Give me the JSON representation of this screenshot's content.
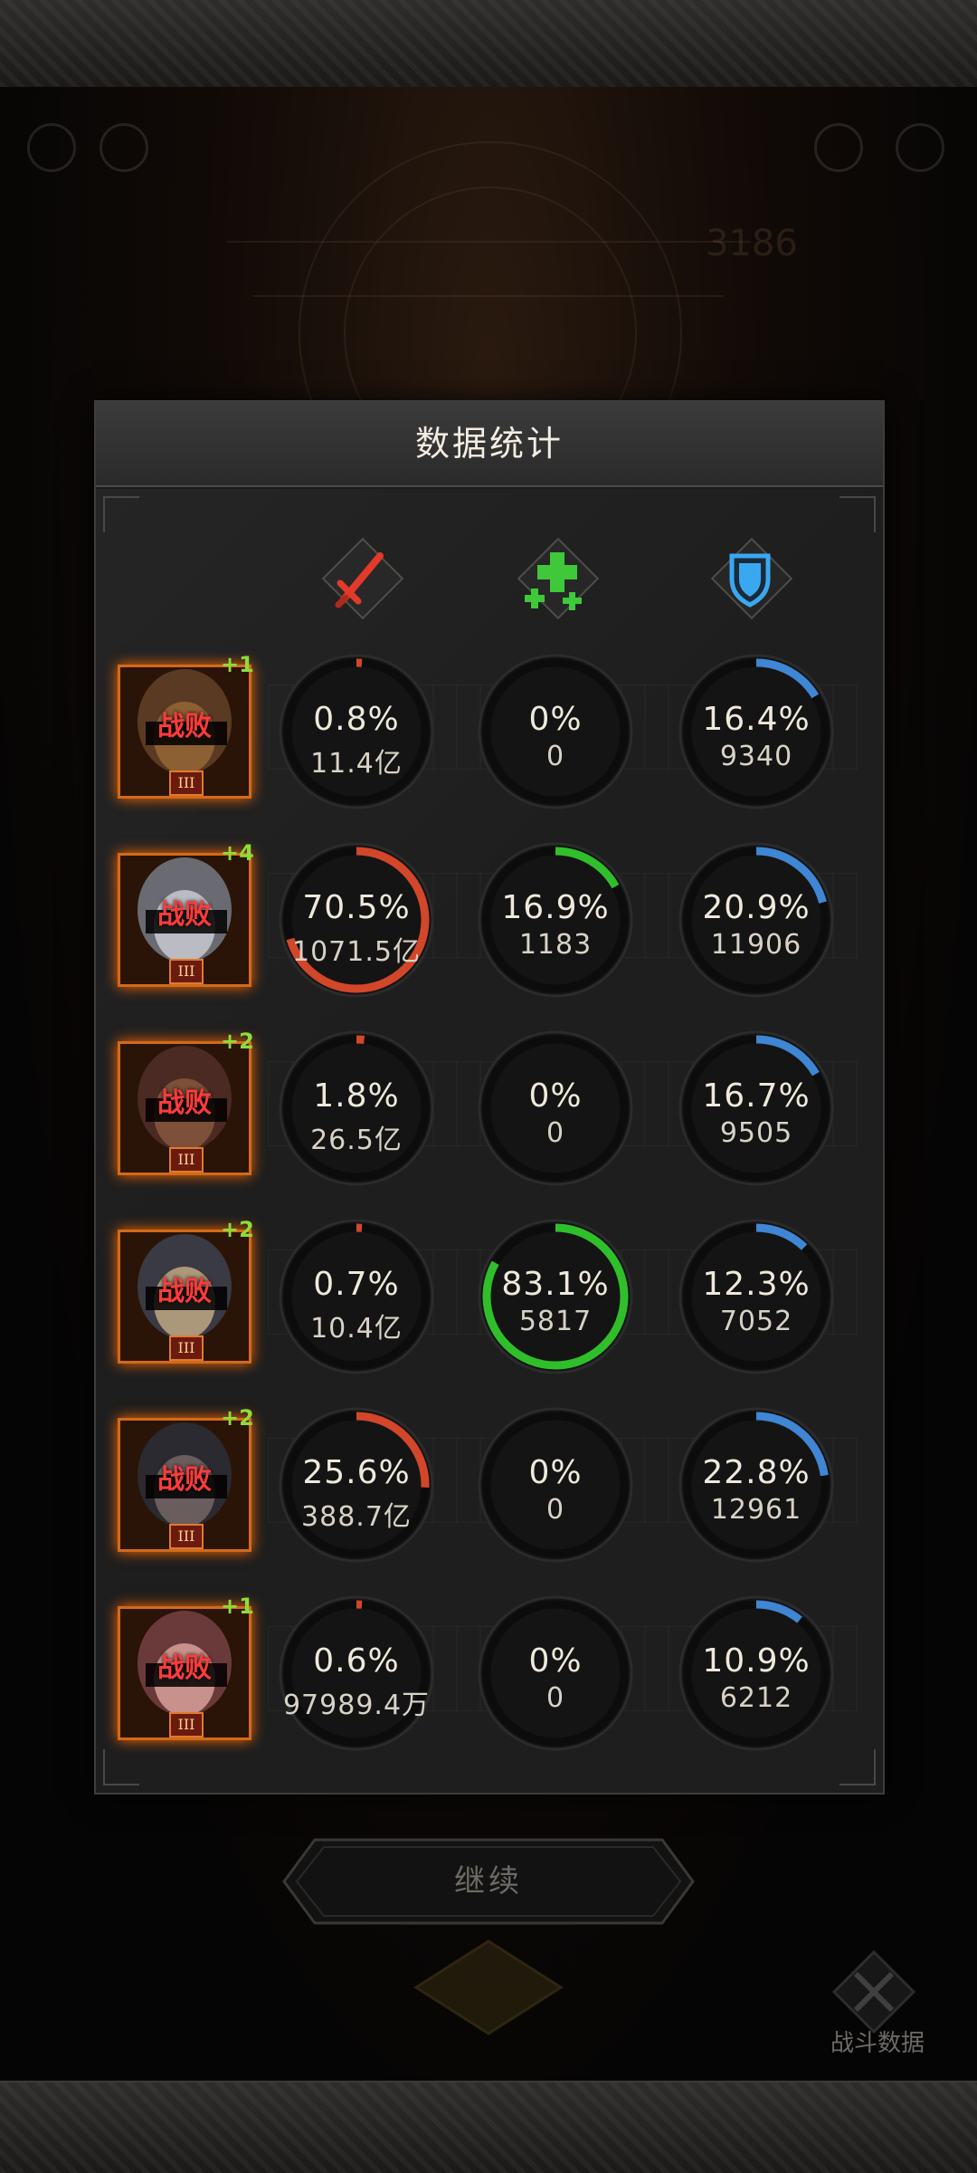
{
  "panel": {
    "title": "数据统计"
  },
  "columns": [
    {
      "icon": "sword-icon",
      "color": "#e23a2a"
    },
    {
      "icon": "heal-cross-icon",
      "color": "#3ec83a"
    },
    {
      "icon": "shield-icon",
      "color": "#3aa8f0"
    }
  ],
  "colors": {
    "damage": "#d2462a",
    "heal": "#2fbf2a",
    "tank": "#3f86d4",
    "defeat": "#ff3b3b",
    "level": "#8edc3a"
  },
  "rows": [
    {
      "plus": "+1",
      "status": "战败",
      "rank": "III",
      "stats": [
        {
          "pct": "0.8%",
          "value": "11.4亿",
          "p": 0.008
        },
        {
          "pct": "0%",
          "value": "0",
          "p": 0
        },
        {
          "pct": "16.4%",
          "value": "9340",
          "p": 0.164
        }
      ]
    },
    {
      "plus": "+4",
      "status": "战败",
      "rank": "III",
      "stats": [
        {
          "pct": "70.5%",
          "value": "1071.5亿",
          "p": 0.705
        },
        {
          "pct": "16.9%",
          "value": "1183",
          "p": 0.169
        },
        {
          "pct": "20.9%",
          "value": "11906",
          "p": 0.209
        }
      ]
    },
    {
      "plus": "+2",
      "status": "战败",
      "rank": "III",
      "stats": [
        {
          "pct": "1.8%",
          "value": "26.5亿",
          "p": 0.018
        },
        {
          "pct": "0%",
          "value": "0",
          "p": 0
        },
        {
          "pct": "16.7%",
          "value": "9505",
          "p": 0.167
        }
      ]
    },
    {
      "plus": "+2",
      "status": "战败",
      "rank": "III",
      "stats": [
        {
          "pct": "0.7%",
          "value": "10.4亿",
          "p": 0.007
        },
        {
          "pct": "83.1%",
          "value": "5817",
          "p": 0.831
        },
        {
          "pct": "12.3%",
          "value": "7052",
          "p": 0.123
        }
      ]
    },
    {
      "plus": "+2",
      "status": "战败",
      "rank": "III",
      "stats": [
        {
          "pct": "25.6%",
          "value": "388.7亿",
          "p": 0.256
        },
        {
          "pct": "0%",
          "value": "0",
          "p": 0
        },
        {
          "pct": "22.8%",
          "value": "12961",
          "p": 0.228
        }
      ]
    },
    {
      "plus": "+1",
      "status": "战败",
      "rank": "III",
      "stats": [
        {
          "pct": "0.6%",
          "value": "97989.4万",
          "p": 0.006
        },
        {
          "pct": "0%",
          "value": "0",
          "p": 0
        },
        {
          "pct": "10.9%",
          "value": "6212",
          "p": 0.109
        }
      ]
    }
  ],
  "continue_button": {
    "label": "继续"
  },
  "battle_data": {
    "label": "战斗数据",
    "icon": "crossed-swords-icon"
  }
}
